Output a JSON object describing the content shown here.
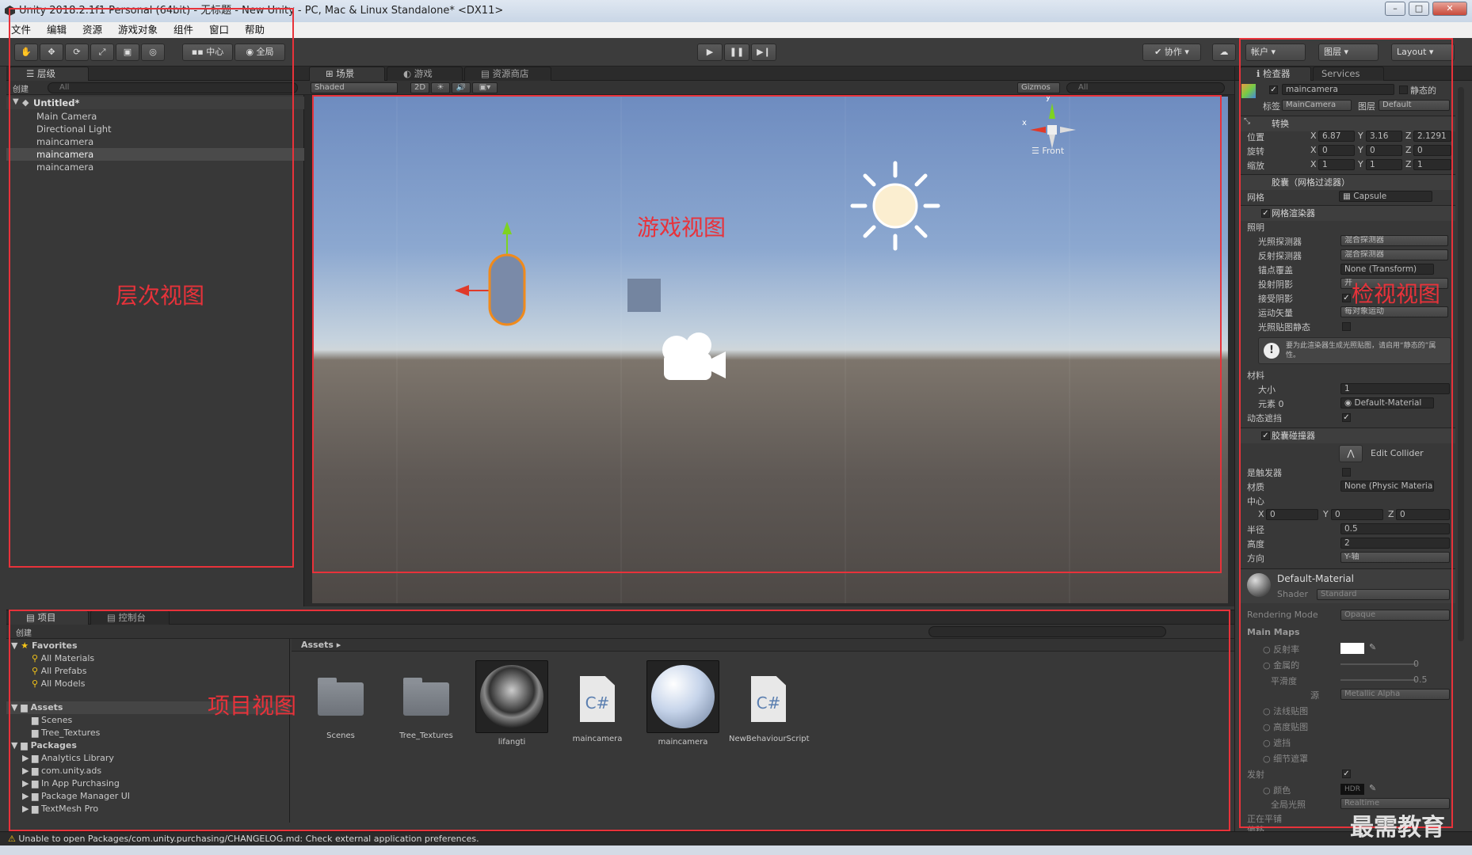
{
  "window": {
    "title": "Unity 2018.2.1f1 Personal (64bit) - 无标题 - New Unity - PC, Mac & Linux Standalone* <DX11>",
    "min": "–",
    "max": "□",
    "close": "✕"
  },
  "menu": [
    "文件",
    "编辑",
    "资源",
    "游戏对象",
    "组件",
    "窗口",
    "帮助"
  ],
  "toolbar": {
    "pivot": "中心",
    "global": "全局",
    "collab": "协作",
    "account": "帐户",
    "layers": "图层",
    "layout": "Layout"
  },
  "hierarchy": {
    "tab": "层级",
    "create": "创建",
    "search_placeholder": "All",
    "scene": "Untitled*",
    "items": [
      "Main Camera",
      "Directional Light",
      "maincamera",
      "maincamera",
      "maincamera"
    ]
  },
  "scene": {
    "tabs": [
      "场景",
      "游戏",
      "资源商店"
    ],
    "shading": "Shaded",
    "mode_2d": "2D",
    "gizmos": "Gizmos",
    "search_placeholder": "All",
    "axis_front": "Front",
    "axis_y": "y",
    "axis_x": "x"
  },
  "inspector": {
    "tabs": [
      "检查器",
      "Services"
    ],
    "object_name": "maincamera",
    "static": "静态的",
    "tag_label": "标签",
    "tag_value": "MainCamera",
    "layer_label": "图层",
    "layer_value": "Default",
    "transform": {
      "title": "转换",
      "position": "位置",
      "rotation": "旋转",
      "scale": "缩放",
      "pos": [
        "6.87",
        "3.16",
        "2.1291"
      ],
      "rot": [
        "0",
        "0",
        "0"
      ],
      "scl": [
        "1",
        "1",
        "1"
      ],
      "x": "X",
      "y": "Y",
      "z": "Z"
    },
    "mesh_filter": {
      "title": "胶囊（网格过滤器）",
      "mesh_label": "网格",
      "mesh_value": "Capsule"
    },
    "mesh_renderer": {
      "title": "网格渲染器",
      "lighting": "照明",
      "light_probes": "光照探测器",
      "light_probes_val": "混合探测器",
      "reflection_probes": "反射探测器",
      "reflection_probes_val": "混合探测器",
      "anchor_override": "锚点覆盖",
      "anchor_override_val": "None (Transform)",
      "cast_shadows": "投射阴影",
      "cast_shadows_val": "开",
      "receive_shadows": "接受阴影",
      "motion_vectors": "运动矢量",
      "motion_vectors_val": "每对象运动",
      "lightmap_static": "光照贴图静态",
      "info": "要为此渲染器生成光照贴图，请启用“静态的”属性。",
      "materials": "材料",
      "size": "大小",
      "size_val": "1",
      "element0": "元素 0",
      "element0_val": "Default-Material",
      "dynamic_occluded": "动态遮挡"
    },
    "capsule_collider": {
      "title": "胶囊碰撞器",
      "edit": "Edit Collider",
      "is_trigger": "是触发器",
      "material": "材质",
      "material_val": "None (Physic Material)",
      "center": "中心",
      "cx": "0",
      "cy": "0",
      "cz": "0",
      "radius": "半径",
      "radius_val": "0.5",
      "height": "高度",
      "height_val": "2",
      "direction": "方向",
      "direction_val": "Y-轴"
    },
    "material": {
      "name": "Default-Material",
      "shader_label": "Shader",
      "shader_val": "Standard",
      "rendering_mode": "Rendering Mode",
      "rendering_mode_val": "Opaque",
      "main_maps": "Main Maps",
      "albedo": "反射率",
      "metallic": "金属的",
      "metallic_val": "0",
      "smoothness": "平滑度",
      "smoothness_val": "0.5",
      "source": "源",
      "source_val": "Metallic Alpha",
      "normal_map": "法线贴图",
      "height_map": "高度贴图",
      "occlusion": "遮挡",
      "detail_mask": "细节遮罩",
      "emission": "发射",
      "color": "颜色",
      "hdr": "HDR",
      "gi": "全局光照",
      "gi_val": "Realtime",
      "tiling": "正在平铺",
      "offset": "偏移"
    }
  },
  "project": {
    "tabs": [
      "项目",
      "控制台"
    ],
    "create": "创建",
    "favorites": "Favorites",
    "fav_items": [
      "All Materials",
      "All Prefabs",
      "All Models"
    ],
    "assets": "Assets",
    "asset_folders": [
      "Scenes",
      "Tree_Textures"
    ],
    "packages": "Packages",
    "package_items": [
      "Analytics Library",
      "com.unity.ads",
      "In App Purchasing",
      "Package Manager UI",
      "TextMesh Pro"
    ],
    "breadcrumb": "Assets ▸",
    "asset_tiles": [
      "Scenes",
      "Tree_Textures",
      "lifangti",
      "maincamera",
      "maincamera",
      "NewBehaviourScript"
    ],
    "cs": "C#"
  },
  "status": {
    "message": "Unable to open Packages/com.unity.purchasing/CHANGELOG.md: Check external application preferences."
  },
  "annotations": {
    "hierarchy": "层次视图",
    "game": "游戏视图",
    "inspector": "检视视图",
    "project": "项目视图"
  },
  "watermark": "最需教育"
}
